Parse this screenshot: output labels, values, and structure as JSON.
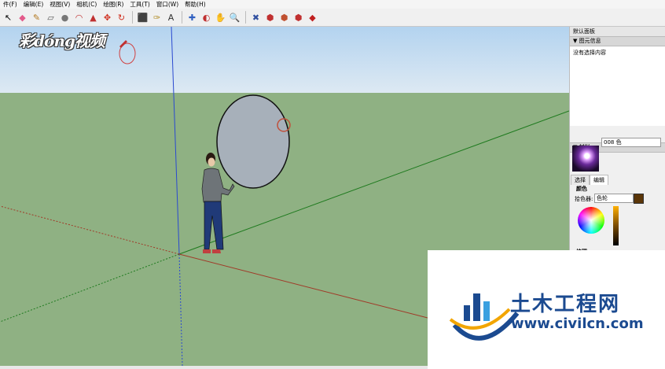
{
  "menu": [
    "件(F)",
    "编辑(E)",
    "视图(V)",
    "相机(C)",
    "绘图(R)",
    "工具(T)",
    "窗口(W)",
    "帮助(H)"
  ],
  "toolbar": {
    "tools": [
      {
        "name": "select-tool-icon",
        "glyph": "↖",
        "color": "#000"
      },
      {
        "name": "eraser-tool-icon",
        "glyph": "◆",
        "color": "#e35a8a"
      },
      {
        "name": "pencil-tool-icon",
        "glyph": "✎",
        "color": "#b2771e"
      },
      {
        "name": "rectangle-tool-icon",
        "glyph": "▱",
        "color": "#5b5b5b"
      },
      {
        "name": "circle-tool-icon",
        "glyph": "●",
        "color": "#777"
      },
      {
        "name": "arc-tool-icon",
        "glyph": "◠",
        "color": "#c03030"
      },
      {
        "name": "push-pull-tool-icon",
        "glyph": "▲",
        "color": "#c03030"
      },
      {
        "name": "move-tool-icon",
        "glyph": "✥",
        "color": "#d03020"
      },
      {
        "name": "rotate-tool-icon",
        "glyph": "↻",
        "color": "#d03020"
      },
      {
        "name": "scale-tool-icon",
        "glyph": "⬛",
        "color": "#c03030"
      },
      {
        "name": "tape-measure-tool-icon",
        "glyph": "✑",
        "color": "#b08a20"
      },
      {
        "name": "text-tool-icon",
        "glyph": "A",
        "color": "#333"
      },
      {
        "name": "axes-tool-icon",
        "glyph": "✚",
        "color": "#3060c0"
      },
      {
        "name": "orbit-tool-icon",
        "glyph": "◐",
        "color": "#c03030"
      },
      {
        "name": "pan-tool-icon",
        "glyph": "✋",
        "color": "#d09a50"
      },
      {
        "name": "zoom-tool-icon",
        "glyph": "🔍",
        "color": "#3050a0"
      },
      {
        "name": "zoom-extents-tool-icon",
        "glyph": "✖",
        "color": "#3050a0"
      },
      {
        "name": "warehouse-icon",
        "glyph": "⬢",
        "color": "#c03030"
      },
      {
        "name": "components-icon",
        "glyph": "⬢",
        "color": "#c05030"
      },
      {
        "name": "extension-icon",
        "glyph": "⬢",
        "color": "#c03030"
      },
      {
        "name": "ruby-icon",
        "glyph": "◆",
        "color": "#c02020"
      }
    ]
  },
  "watermark_logo": "彩dóng视频",
  "panel": {
    "title": "默认面板",
    "entity_info_header": "▼ 图元信息",
    "entity_info_text": "没有选择内容",
    "materials_header": "▼ 材料",
    "material_name": "008 色",
    "tab_select": "选择",
    "tab_edit": "编辑",
    "color_label": "颜色",
    "picker_label": "拾色器:",
    "picker_value": "色轮",
    "texture_label": "纹理"
  },
  "overlay": {
    "site_name": "土木工程网",
    "site_url": "www.civilcn.com"
  },
  "colors": {
    "sky_top": "#b3d3ef",
    "ground": "#8fb183",
    "axis_blue": "#2a49d0",
    "axis_green": "#1e7a1e",
    "axis_red": "#a03a28",
    "circle_fill": "#a7b0ba",
    "brand_blue": "#1b4a90",
    "swatch": "#5b3608"
  }
}
